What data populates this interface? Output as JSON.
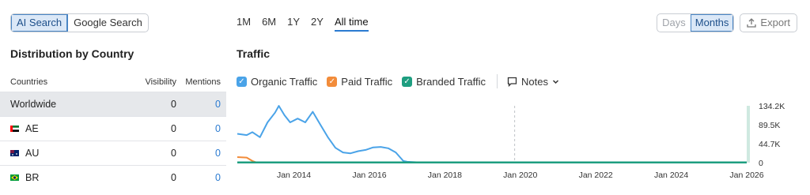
{
  "source_toggle": {
    "ai_search": "AI Search",
    "google_search": "Google Search"
  },
  "periods": [
    "1M",
    "6M",
    "1Y",
    "2Y",
    "All time"
  ],
  "granularity": {
    "days": "Days",
    "months": "Months"
  },
  "export_label": "Export",
  "distribution": {
    "title": "Distribution by Country",
    "columns": {
      "country": "Countries",
      "visibility": "Visibility",
      "mentions": "Mentions"
    },
    "rows": [
      {
        "country": "Worldwide",
        "visibility": "0",
        "mentions": "0"
      },
      {
        "country": "AE",
        "visibility": "0",
        "mentions": "0"
      },
      {
        "country": "AU",
        "visibility": "0",
        "mentions": "0"
      },
      {
        "country": "BR",
        "visibility": "0",
        "mentions": "0"
      }
    ]
  },
  "traffic": {
    "title": "Traffic",
    "legend": {
      "organic": "Organic Traffic",
      "paid": "Paid Traffic",
      "branded": "Branded Traffic",
      "notes": "Notes"
    }
  },
  "colors": {
    "organic": "#4aa3e8",
    "paid": "#f28c3a",
    "branded": "#1e9e80"
  },
  "chart_data": {
    "type": "line",
    "x_ticks": [
      "Jan 2014",
      "Jan 2016",
      "Jan 2018",
      "Jan 2020",
      "Jan 2022",
      "Jan 2024",
      "Jan 2026"
    ],
    "y_ticks": [
      "134.2K",
      "89.5K",
      "44.7K",
      "0"
    ],
    "ylim": [
      0,
      134200
    ],
    "series": [
      {
        "name": "Organic Traffic",
        "x": [
          2012.5,
          2012.75,
          2012.9,
          2013.1,
          2013.3,
          2013.5,
          2013.6,
          2013.75,
          2013.9,
          2014.1,
          2014.3,
          2014.5,
          2014.7,
          2014.9,
          2015.1,
          2015.3,
          2015.5,
          2015.7,
          2015.9,
          2016.1,
          2016.3,
          2016.5,
          2016.7,
          2016.8,
          2016.9,
          2017.0,
          2017.3,
          2026.0
        ],
        "values": [
          68000,
          65000,
          72000,
          60000,
          95000,
          118000,
          134000,
          112000,
          95000,
          104000,
          95000,
          120000,
          90000,
          60000,
          35000,
          24000,
          22000,
          27000,
          30000,
          36000,
          37000,
          34000,
          24000,
          14000,
          4000,
          2000,
          800,
          800
        ]
      },
      {
        "name": "Paid Traffic",
        "x": [
          2012.5,
          2012.75,
          2012.9,
          2013.0,
          2026.0
        ],
        "values": [
          13000,
          12000,
          4000,
          500,
          0
        ]
      },
      {
        "name": "Branded Traffic",
        "x": [
          2012.5,
          2026.0
        ],
        "values": [
          300,
          300
        ]
      }
    ]
  }
}
